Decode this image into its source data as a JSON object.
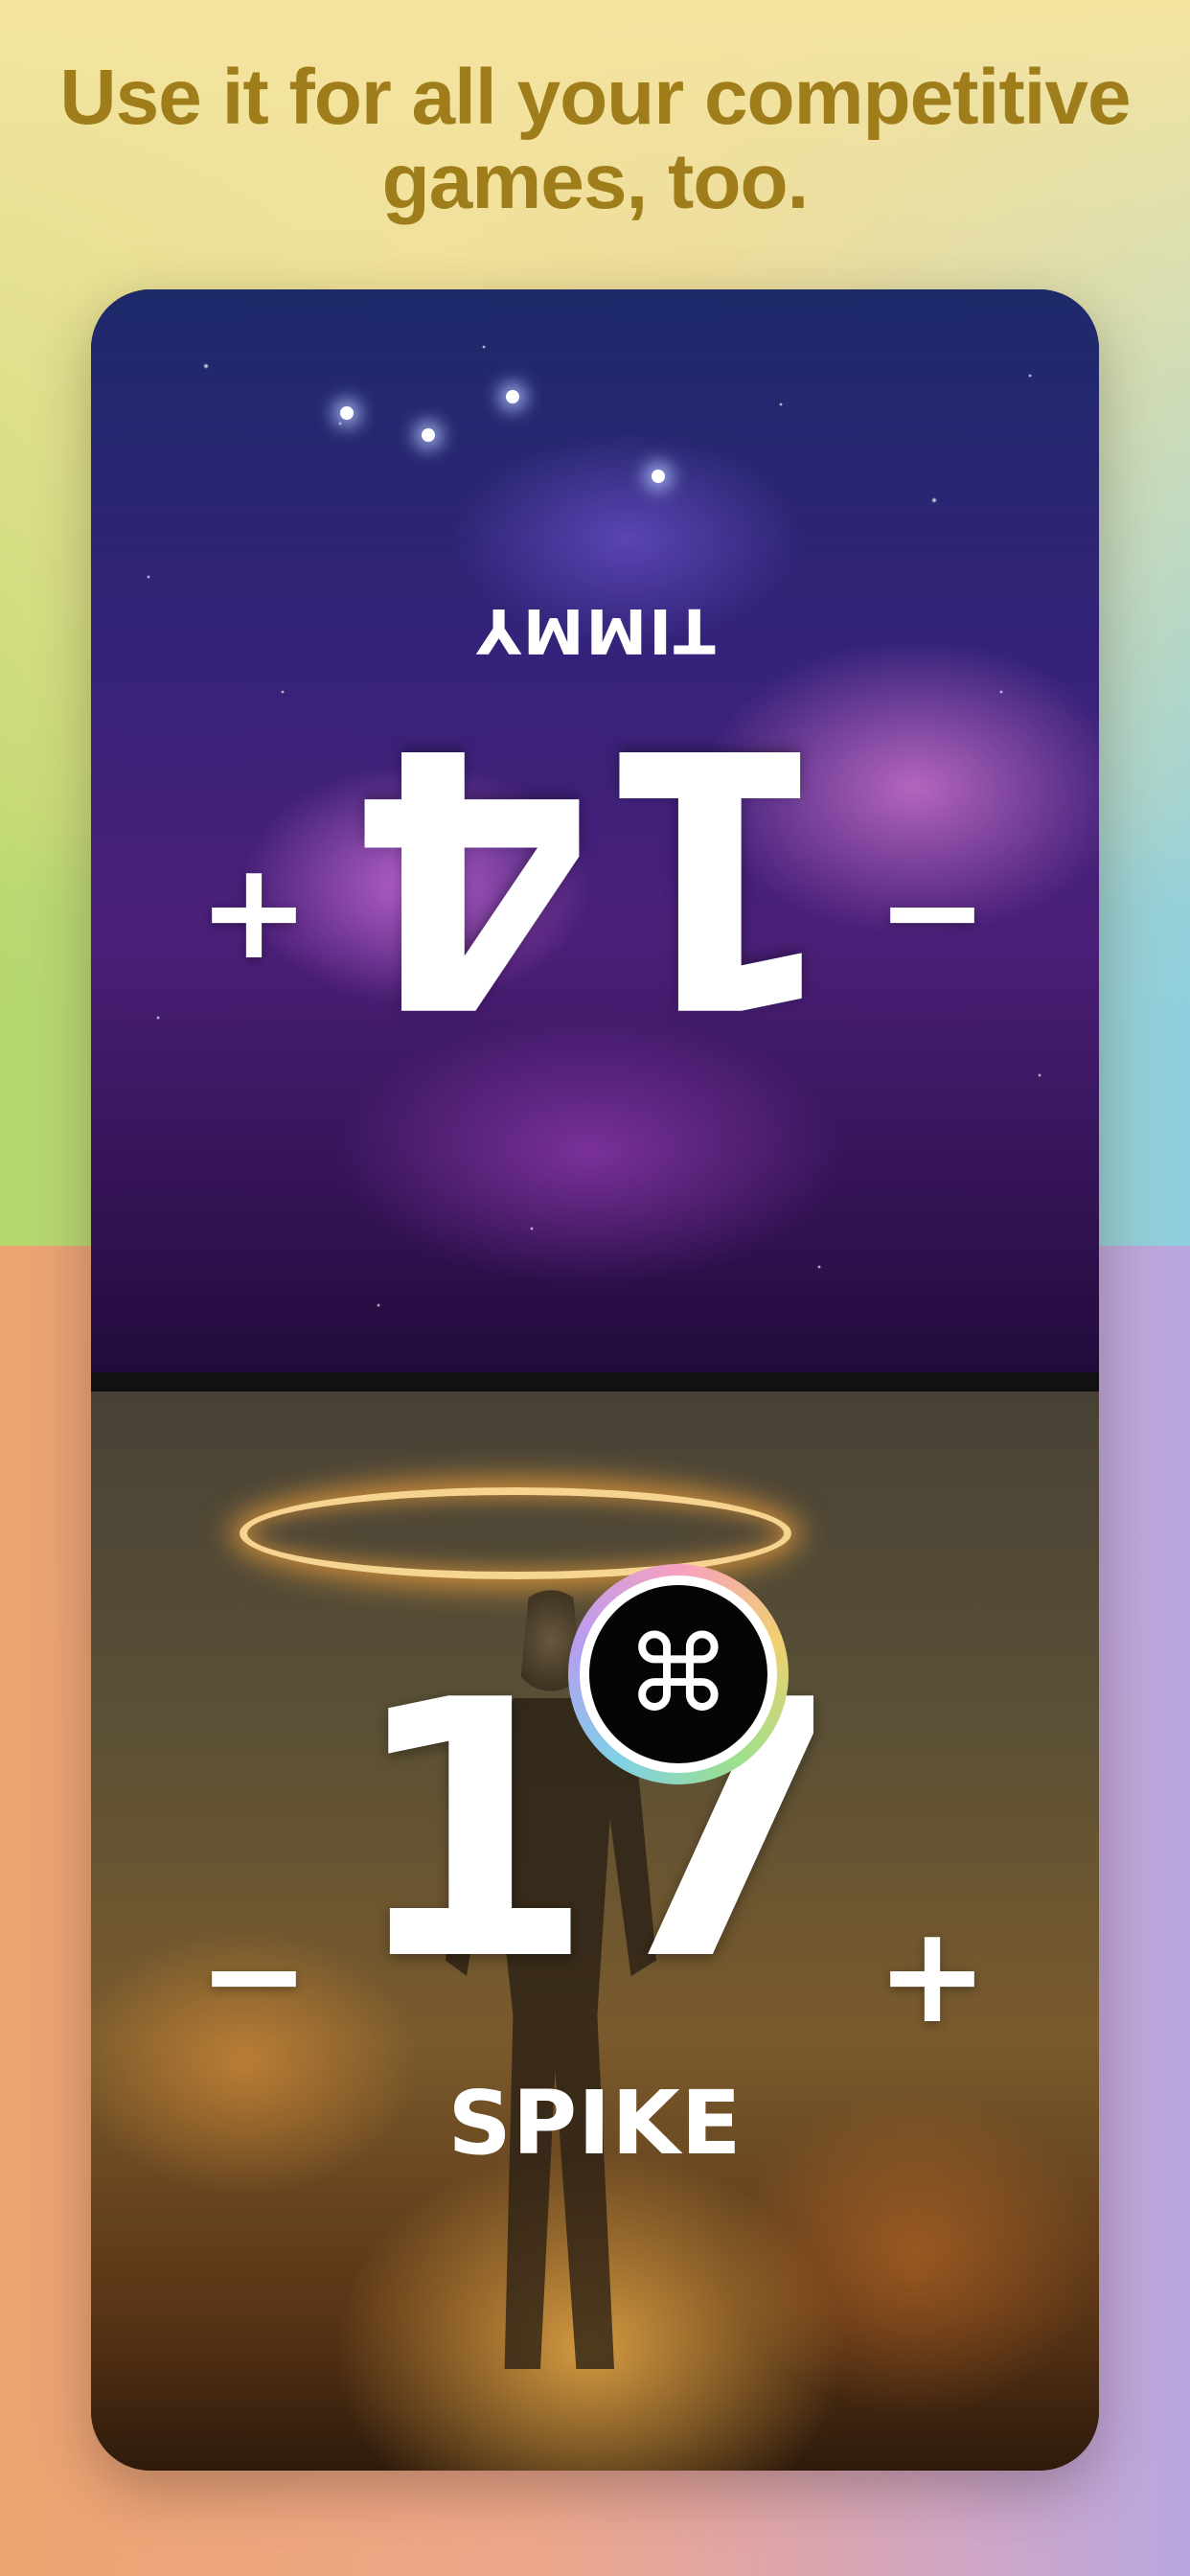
{
  "headline": "Use it for all your competitive games, too.",
  "players": [
    {
      "name": "TIMMY",
      "score": "14",
      "orientation": "upside-down"
    },
    {
      "name": "SPIKE",
      "score": "17",
      "orientation": "upright"
    }
  ],
  "controls": {
    "increment": "+",
    "decrement": "−"
  },
  "menu_button": {
    "icon": "command-icon",
    "glyph": "⌘"
  },
  "colors": {
    "headline": "#9f7d1a",
    "score_text": "#ffffff"
  }
}
